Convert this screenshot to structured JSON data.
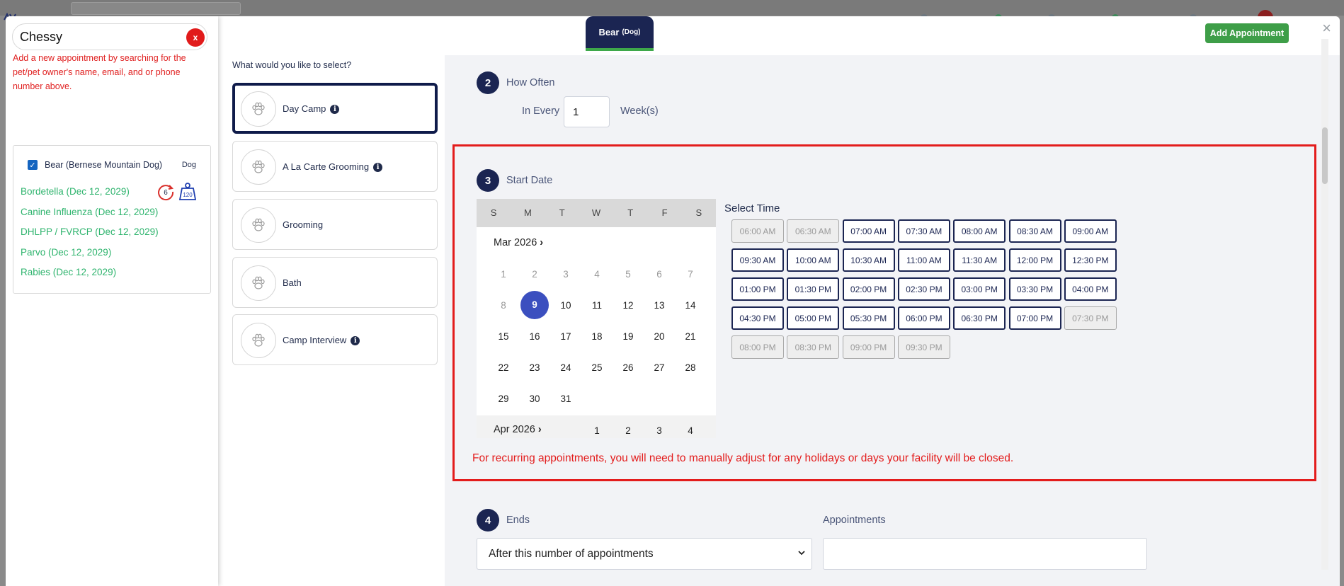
{
  "search": {
    "value": "Chessy",
    "clear_label": "x"
  },
  "help_text": "Add a new appointment by searching for the pet/pet owner's name, email, and or phone number above.",
  "pet": {
    "name": "Bear (Bernese Mountain Dog)",
    "species": "Dog",
    "badge_count": "6",
    "weight": "120",
    "vaccines": [
      "Bordetella (Dec 12, 2029)",
      "Canine Influenza (Dec 12, 2029)",
      "DHLPP / FVRCP (Dec 12, 2029)",
      "Parvo (Dec 12, 2029)",
      "Rabies (Dec 12, 2029)"
    ]
  },
  "services": {
    "question": "What would you like to select?",
    "items": [
      {
        "label": "Day Camp",
        "info": "i"
      },
      {
        "label": "A La Carte Grooming",
        "info": "i"
      },
      {
        "label": "Grooming"
      },
      {
        "label": "Bath"
      },
      {
        "label": "Camp Interview",
        "info": "i"
      }
    ]
  },
  "tab": {
    "pet": "Bear",
    "species": "(Dog)"
  },
  "add_appointment": "Add Appointment",
  "close": "×",
  "how_often": {
    "step": "2",
    "title": "How Often",
    "in_every": "In Every",
    "value": "1",
    "unit": "Week(s)"
  },
  "start_date": {
    "step": "3",
    "title": "Start Date",
    "weekdays": [
      "S",
      "M",
      "T",
      "W",
      "T",
      "F",
      "S"
    ],
    "month1": "Mar 2026",
    "prev_days": [
      "1",
      "2",
      "3",
      "4",
      "5",
      "6",
      "7",
      "8"
    ],
    "selected_day": "9",
    "days": [
      "10",
      "11",
      "12",
      "13",
      "14",
      "15",
      "16",
      "17",
      "18",
      "19",
      "20",
      "21",
      "22",
      "23",
      "24",
      "25",
      "26",
      "27",
      "28",
      "29",
      "30",
      "31"
    ],
    "month2": "Apr 2026",
    "month2_days": [
      "1",
      "2",
      "3",
      "4"
    ],
    "select_time": "Select Time",
    "times": [
      {
        "label": "06:00 AM",
        "disabled": true
      },
      {
        "label": "06:30 AM",
        "disabled": true
      },
      {
        "label": "07:00 AM"
      },
      {
        "label": "07:30 AM"
      },
      {
        "label": "08:00 AM"
      },
      {
        "label": "08:30 AM"
      },
      {
        "label": "09:00 AM"
      },
      {
        "label": "09:30 AM"
      },
      {
        "label": "10:00 AM"
      },
      {
        "label": "10:30 AM"
      },
      {
        "label": "11:00 AM"
      },
      {
        "label": "11:30 AM"
      },
      {
        "label": "12:00 PM"
      },
      {
        "label": "12:30 PM"
      },
      {
        "label": "01:00 PM"
      },
      {
        "label": "01:30 PM"
      },
      {
        "label": "02:00 PM"
      },
      {
        "label": "02:30 PM"
      },
      {
        "label": "03:00 PM"
      },
      {
        "label": "03:30 PM"
      },
      {
        "label": "04:00 PM"
      },
      {
        "label": "04:30 PM"
      },
      {
        "label": "05:00 PM"
      },
      {
        "label": "05:30 PM"
      },
      {
        "label": "06:00 PM"
      },
      {
        "label": "06:30 PM"
      },
      {
        "label": "07:00 PM"
      },
      {
        "label": "07:30 PM",
        "disabled": true
      },
      {
        "label": "08:00 PM",
        "disabled": true
      },
      {
        "label": "08:30 PM",
        "disabled": true
      },
      {
        "label": "09:00 PM",
        "disabled": true
      },
      {
        "label": "09:30 PM",
        "disabled": true
      }
    ],
    "warning": "For recurring appointments, you will need to manually adjust for any holidays or days your facility will be closed."
  },
  "ends": {
    "step": "4",
    "title": "Ends",
    "selected": "After this number of appointments",
    "appointments_label": "Appointments",
    "appointments_value": ""
  }
}
